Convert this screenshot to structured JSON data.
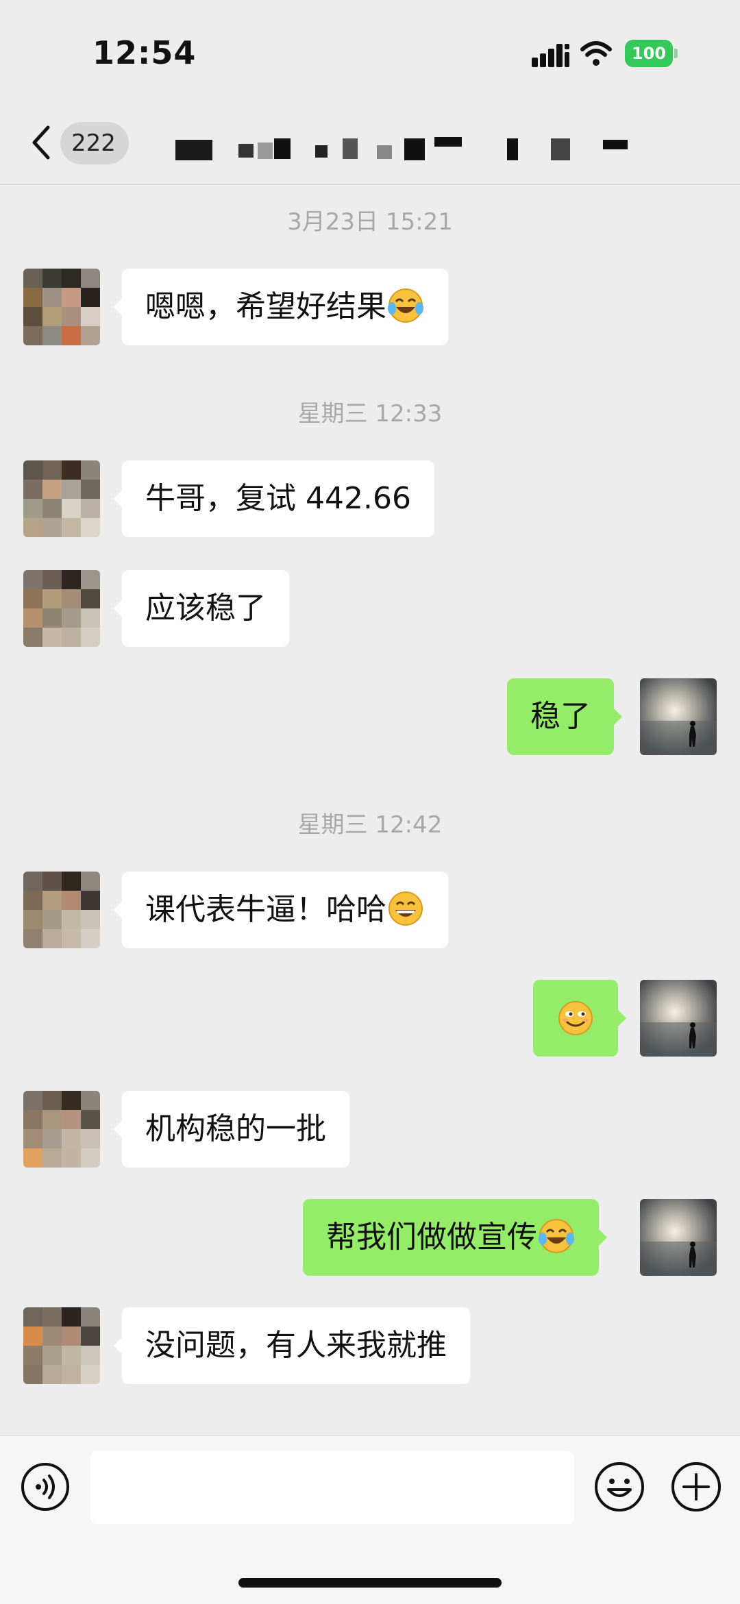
{
  "status_bar": {
    "time": "12:54",
    "battery": "100",
    "icons": [
      "signal-icon",
      "wifi-icon",
      "battery-icon"
    ],
    "battery_color": "#34c759"
  },
  "nav": {
    "back_icon": "chevron-left-icon",
    "unread_count": "222",
    "title_redacted": true
  },
  "colors": {
    "background": "#ededed",
    "incoming_bubble": "#ffffff",
    "outgoing_bubble": "#95ec69",
    "timestamp": "#a8a8a8"
  },
  "timestamps": [
    "3月23日 15:21",
    "星期三 12:33",
    "星期三 12:42"
  ],
  "messages": [
    {
      "side": "left",
      "text": "嗯嗯，希望好结果",
      "emoji": "laughing-tears-emoji"
    },
    {
      "side": "left",
      "text": "牛哥，复试 442.66",
      "emoji": ""
    },
    {
      "side": "left",
      "text": "应该稳了",
      "emoji": ""
    },
    {
      "side": "right",
      "text": "稳了",
      "emoji": ""
    },
    {
      "side": "left",
      "text": "课代表牛逼！哈哈",
      "emoji": "grinning-emoji"
    },
    {
      "side": "right",
      "text": "",
      "emoji": "smirk-emoji"
    },
    {
      "side": "left",
      "text": "机构稳的一批",
      "emoji": ""
    },
    {
      "side": "right",
      "text": "帮我们做做宣传",
      "emoji": "laughing-tears-emoji"
    },
    {
      "side": "left",
      "text": "没问题，有人来我就推",
      "emoji": ""
    }
  ],
  "input_bar": {
    "voice_icon": "voice-icon",
    "emoji_icon": "emoji-icon",
    "plus_icon": "plus-icon",
    "input_value": ""
  }
}
